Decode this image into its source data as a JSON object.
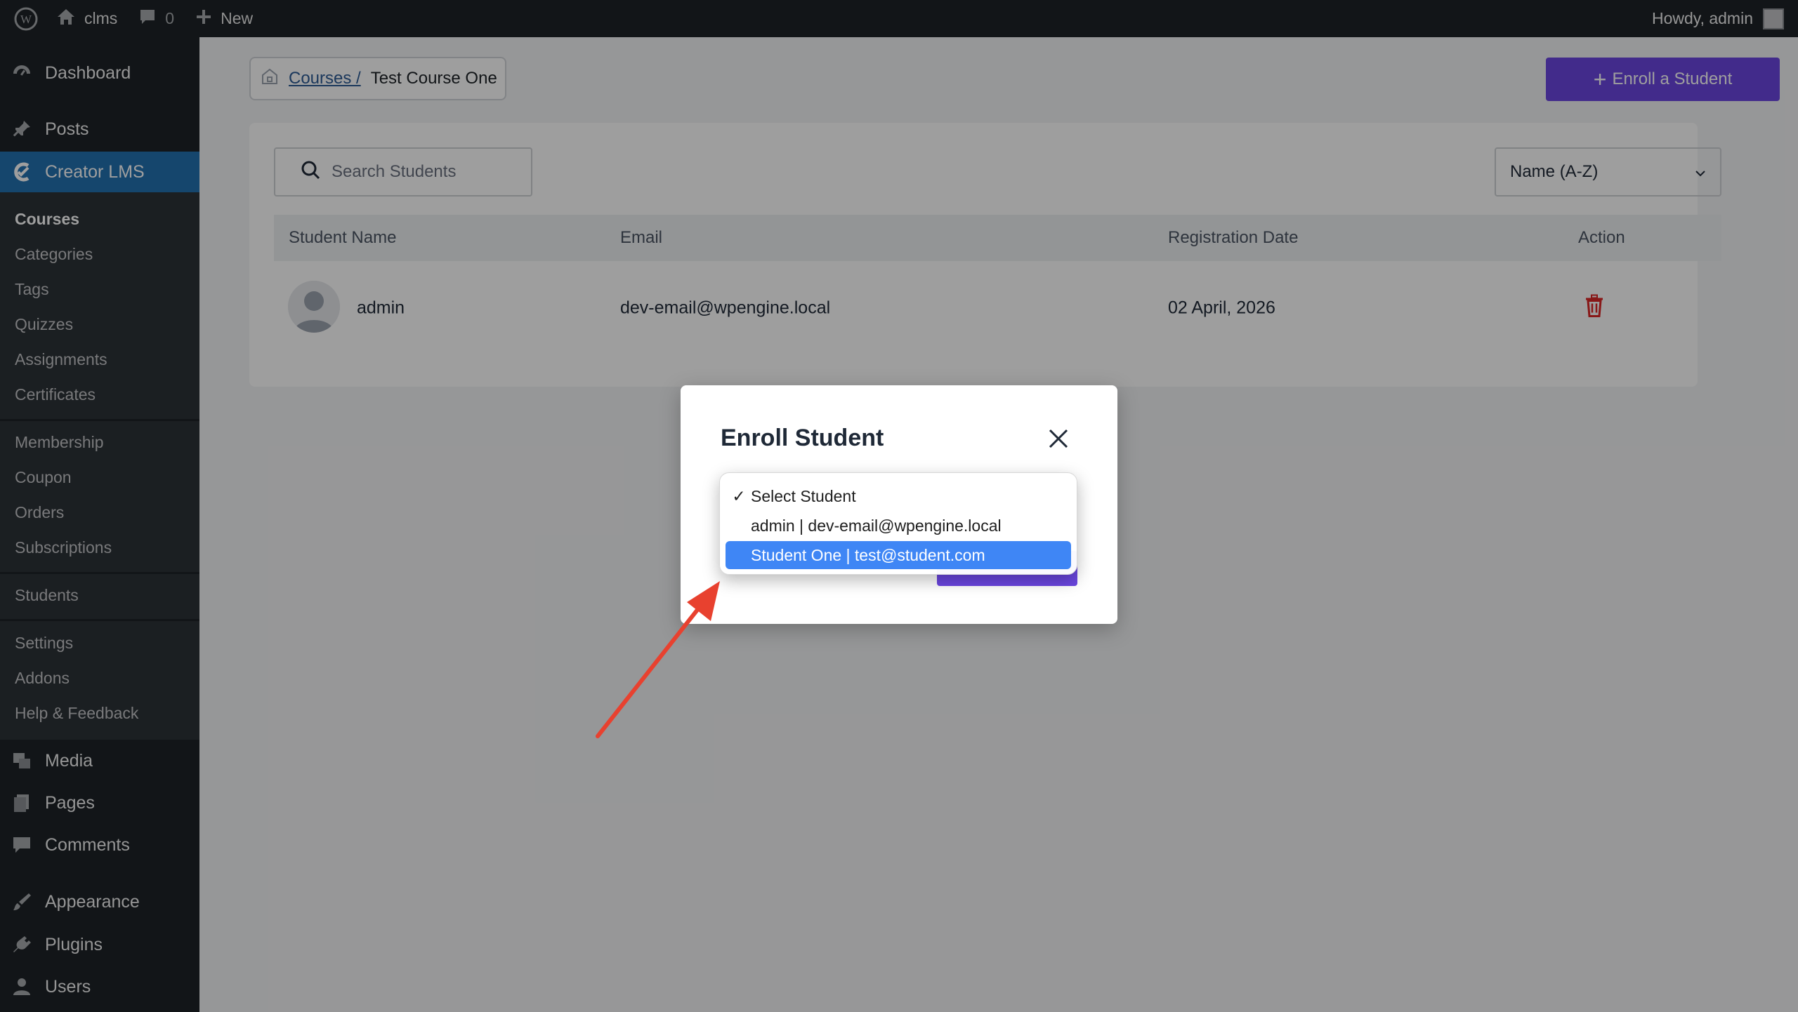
{
  "adminbar": {
    "site_name": "clms",
    "comments_count": "0",
    "new_label": "New",
    "howdy": "Howdy, admin"
  },
  "sidebar": {
    "dashboard": "Dashboard",
    "posts": "Posts",
    "creator_lms": "Creator LMS",
    "submenu": [
      "Courses",
      "Categories",
      "Tags",
      "Quizzes",
      "Assignments",
      "Certificates",
      "Membership",
      "Coupon",
      "Orders",
      "Subscriptions",
      "Students",
      "Settings",
      "Addons",
      "Help & Feedback"
    ],
    "media": "Media",
    "pages": "Pages",
    "comments": "Comments",
    "appearance": "Appearance",
    "plugins": "Plugins",
    "users": "Users"
  },
  "breadcrumb": {
    "link": "Courses /",
    "current": "Test Course One"
  },
  "enroll_button": "Enroll a Student",
  "search": {
    "placeholder": "Search Students"
  },
  "sort": {
    "selected": "Name (A-Z)"
  },
  "table": {
    "headers": [
      "Student Name",
      "Email",
      "Registration Date",
      "Action"
    ],
    "rows": [
      {
        "name": "admin",
        "email": "dev-email@wpengine.local",
        "date": "02 April, 2026"
      }
    ]
  },
  "modal": {
    "title": "Enroll Student",
    "options": [
      {
        "label": "Select Student",
        "checked": true
      },
      {
        "label": "admin | dev-email@wpengine.local",
        "checked": false
      },
      {
        "label": "Student One | test@student.com",
        "checked": false,
        "highlighted": true
      }
    ]
  },
  "colors": {
    "accent": "#6b46e0",
    "highlight": "#3f86f5",
    "annotation_arrow": "#e8412f",
    "delete": "#dc2626"
  }
}
